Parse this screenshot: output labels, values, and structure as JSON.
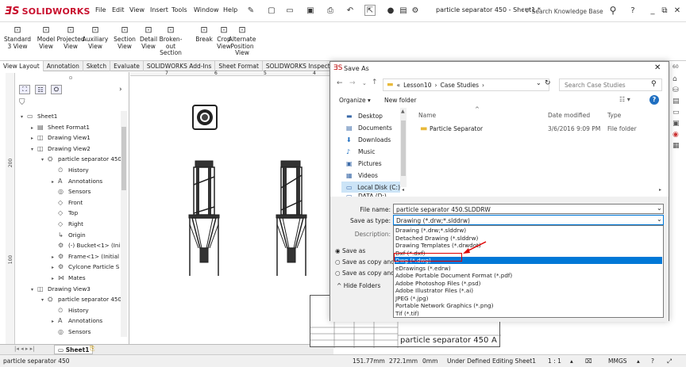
{
  "app": {
    "brand": "SOLIDWORKS",
    "menus": [
      "File",
      "Edit",
      "View",
      "Insert",
      "Tools",
      "Window",
      "Help"
    ],
    "document_title": "particle separator 450 - Sheet1 *",
    "search_placeholder": "Search Knowledge Base"
  },
  "ribbon": {
    "buttons": [
      {
        "label": "Standard\n3 View",
        "icon": "standard-3-view-icon"
      },
      {
        "label": "Model\nView",
        "icon": "model-view-icon"
      },
      {
        "label": "Projected\nView",
        "icon": "projected-view-icon"
      },
      {
        "label": "Auxiliary\nView",
        "icon": "auxiliary-view-icon"
      },
      {
        "label": "Section\nView",
        "icon": "section-view-icon"
      },
      {
        "label": "Detail\nView",
        "icon": "detail-view-icon"
      },
      {
        "label": "Broken-out\nSection",
        "icon": "broken-out-section-icon"
      },
      {
        "label": "Break",
        "icon": "break-icon"
      },
      {
        "label": "Crop\nView",
        "icon": "crop-view-icon"
      },
      {
        "label": "Alternate\nPosition\nView",
        "icon": "alternate-position-view-icon"
      }
    ]
  },
  "tabs": [
    "View Layout",
    "Annotation",
    "Sketch",
    "Evaluate",
    "SOLIDWORKS Add-Ins",
    "Sheet Format",
    "SOLIDWORKS Inspection"
  ],
  "tree": {
    "items": [
      {
        "label": "Sheet1",
        "depth": 0,
        "twisty": "▾",
        "icon": "sheet-icon"
      },
      {
        "label": "Sheet Format1",
        "depth": 1,
        "twisty": "▸",
        "icon": "sheet-format-icon"
      },
      {
        "label": "Drawing View1",
        "depth": 1,
        "twisty": "▸",
        "icon": "drawing-view-icon"
      },
      {
        "label": "Drawing View2",
        "depth": 1,
        "twisty": "▾",
        "icon": "drawing-view-icon"
      },
      {
        "label": "particle separator 450‹",
        "depth": 2,
        "twisty": "▾",
        "icon": "assembly-icon"
      },
      {
        "label": "History",
        "depth": 3,
        "twisty": "",
        "icon": "history-icon"
      },
      {
        "label": "Annotations",
        "depth": 3,
        "twisty": "▸",
        "icon": "annotations-icon"
      },
      {
        "label": "Sensors",
        "depth": 3,
        "twisty": "",
        "icon": "sensors-icon"
      },
      {
        "label": "Front",
        "depth": 3,
        "twisty": "",
        "icon": "plane-icon"
      },
      {
        "label": "Top",
        "depth": 3,
        "twisty": "",
        "icon": "plane-icon"
      },
      {
        "label": "Right",
        "depth": 3,
        "twisty": "",
        "icon": "plane-icon"
      },
      {
        "label": "Origin",
        "depth": 3,
        "twisty": "",
        "icon": "origin-icon"
      },
      {
        "label": "(-) Bucket<1> (Ini",
        "depth": 3,
        "twisty": "",
        "icon": "part-icon"
      },
      {
        "label": "Frame<1> (Initial",
        "depth": 3,
        "twisty": "▸",
        "icon": "part-icon"
      },
      {
        "label": "Cylcone Particle S",
        "depth": 3,
        "twisty": "▸",
        "icon": "part-icon"
      },
      {
        "label": "Mates",
        "depth": 3,
        "twisty": "▸",
        "icon": "mates-icon"
      },
      {
        "label": "Drawing View3",
        "depth": 1,
        "twisty": "▾",
        "icon": "drawing-view-icon"
      },
      {
        "label": "particle separator 450‹",
        "depth": 2,
        "twisty": "▾",
        "icon": "assembly-icon"
      },
      {
        "label": "History",
        "depth": 3,
        "twisty": "",
        "icon": "history-icon"
      },
      {
        "label": "Annotations",
        "depth": 3,
        "twisty": "▸",
        "icon": "annotations-icon"
      },
      {
        "label": "Sensors",
        "depth": 3,
        "twisty": "",
        "icon": "sensors-icon"
      }
    ]
  },
  "ruler_labels": [
    "200",
    "100"
  ],
  "canvas_ruler_labels": [
    "7",
    "6",
    "5",
    "4"
  ],
  "sheet_tab": "Sheet1",
  "status": {
    "doc": "particle separator 450",
    "x": "151.77mm",
    "y": "272.1mm",
    "z": "0mm",
    "state": "Under Defined",
    "editing": "Editing Sheet1",
    "scale": "1 : 1",
    "units": "MMGS"
  },
  "titleblock_text": "particle separator 450",
  "titleblock_letter": "A",
  "dialog": {
    "title": "Save As",
    "breadcrumb": [
      "Lesson10",
      "Case Studies"
    ],
    "breadcrumb_prefix": "«",
    "search_placeholder": "Search Case Studies",
    "organize": "Organize ▾",
    "new_folder": "New folder",
    "nav": [
      {
        "label": "Desktop",
        "icon": "desktop-icon"
      },
      {
        "label": "Documents",
        "icon": "documents-icon"
      },
      {
        "label": "Downloads",
        "icon": "downloads-icon"
      },
      {
        "label": "Music",
        "icon": "music-icon"
      },
      {
        "label": "Pictures",
        "icon": "pictures-icon"
      },
      {
        "label": "Videos",
        "icon": "videos-icon"
      },
      {
        "label": "Local Disk (C:)",
        "icon": "disk-icon"
      },
      {
        "label": "DATA (D:)",
        "icon": "disk-icon"
      }
    ],
    "columns": {
      "name": "Name",
      "date": "Date modified",
      "type": "Type"
    },
    "files": [
      {
        "name": "Particle Separator",
        "date": "3/6/2016 9:09 PM",
        "type": "File folder"
      }
    ],
    "file_name_label": "File name:",
    "file_name": "particle separator 450.SLDDRW",
    "save_type_label": "Save as type:",
    "save_type": "Drawing (*.drw;*.slddrw)",
    "description_label": "Description:",
    "options": [
      "Save as",
      "Save as copy and c",
      "Save as copy and c"
    ],
    "hide_folders": "Hide Folders",
    "dropdown": [
      "Drawing (*.drw;*.slddrw)",
      "Detached Drawing (*.slddrw)",
      "Drawing Templates (*.drwdot)",
      "Dxf (*.dxf)",
      "Dwg (*.dwg)",
      "eDrawings (*.edrw)",
      "Adobe Portable Document Format (*.pdf)",
      "Adobe Photoshop Files (*.psd)",
      "Adobe Illustrator Files (*.ai)",
      "JPEG (*.jpg)",
      "Portable Network Graphics (*.png)",
      "Tif (*.tif)"
    ],
    "selected_index": 4
  },
  "colors": {
    "brand": "#c8102e",
    "selection": "#0078d7",
    "highlight": "#e00000"
  }
}
